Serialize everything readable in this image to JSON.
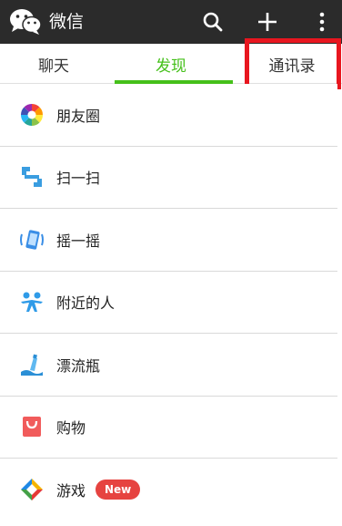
{
  "app": {
    "title": "微信"
  },
  "tabs": [
    {
      "label": "聊天",
      "active": false
    },
    {
      "label": "发现",
      "active": true
    },
    {
      "label": "通讯录",
      "active": false
    }
  ],
  "menu": {
    "items": [
      {
        "label": "朋友圈",
        "icon": "moments-icon"
      },
      {
        "label": "扫一扫",
        "icon": "scan-icon"
      },
      {
        "label": "摇一摇",
        "icon": "shake-icon"
      },
      {
        "label": "附近的人",
        "icon": "people-nearby-icon"
      },
      {
        "label": "漂流瓶",
        "icon": "drift-bottle-icon"
      },
      {
        "label": "购物",
        "icon": "shopping-icon"
      },
      {
        "label": "游戏",
        "icon": "games-icon",
        "badge": "New"
      }
    ]
  },
  "colors": {
    "topbar": "#2b2b2b",
    "accent": "#45c01a",
    "highlight": "#e8161f",
    "badge": "#e64340"
  }
}
